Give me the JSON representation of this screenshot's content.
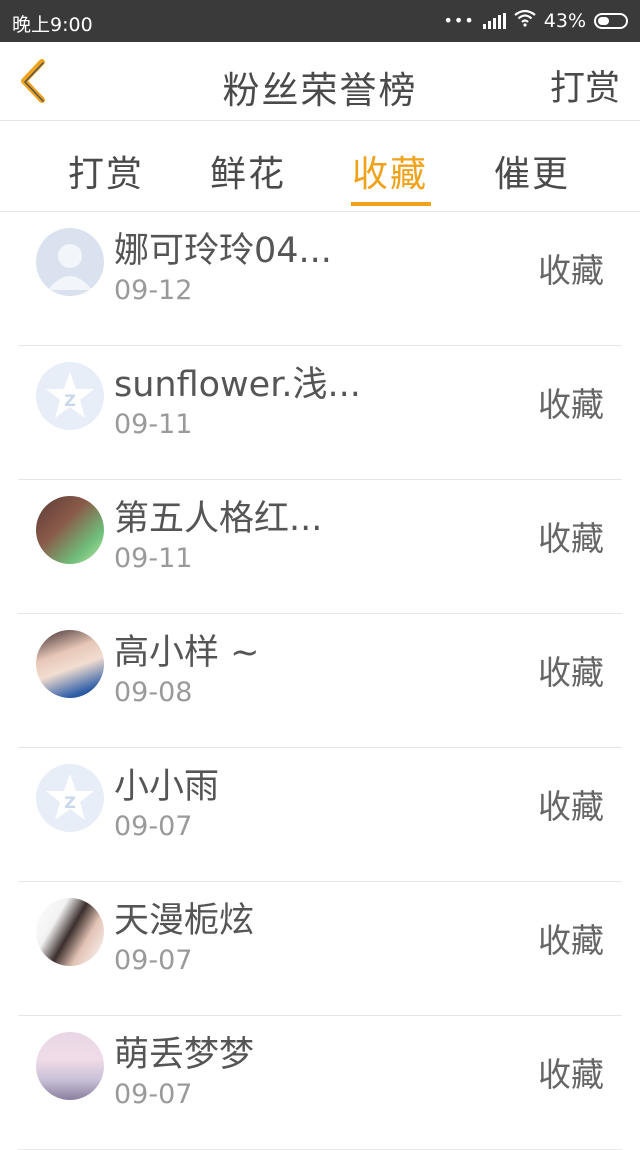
{
  "status": {
    "time": "晚上9:00",
    "battery": "43%",
    "battery_level": 0.43
  },
  "header": {
    "title": "粉丝荣誉榜",
    "action": "打赏",
    "back_icon": "chevron-left-icon"
  },
  "tabs": [
    {
      "label": "打赏",
      "active": false
    },
    {
      "label": "鲜花",
      "active": false
    },
    {
      "label": "收藏",
      "active": true
    },
    {
      "label": "催更",
      "active": false
    }
  ],
  "colors": {
    "accent": "#f0a21a",
    "statusbar": "#3a3a3a",
    "back_icon": "#f0a21a"
  },
  "list": [
    {
      "name": "娜可玲玲04...",
      "date": "09-12",
      "type": "收藏",
      "avatar": "default-person-avatar"
    },
    {
      "name": "sunflower.浅...",
      "date": "09-11",
      "type": "收藏",
      "avatar": "qzone-star-avatar"
    },
    {
      "name": "第五人格红...",
      "date": "09-11",
      "type": "收藏",
      "avatar": "photo-avatar"
    },
    {
      "name": "高小样 ~",
      "date": "09-08",
      "type": "收藏",
      "avatar": "photo-avatar"
    },
    {
      "name": "小小雨",
      "date": "09-07",
      "type": "收藏",
      "avatar": "qzone-star-avatar"
    },
    {
      "name": "天漫栀炫",
      "date": "09-07",
      "type": "收藏",
      "avatar": "photo-avatar"
    },
    {
      "name": "萌丢梦梦",
      "date": "09-07",
      "type": "收藏",
      "avatar": "photo-avatar"
    }
  ]
}
